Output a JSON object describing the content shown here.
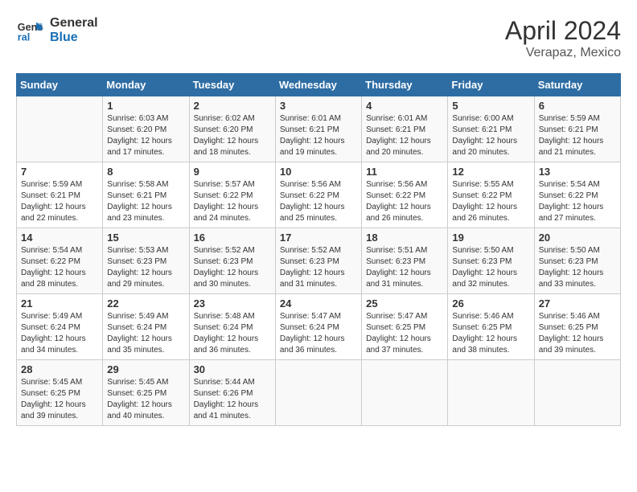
{
  "logo": {
    "line1": "General",
    "line2": "Blue"
  },
  "title": "April 2024",
  "subtitle": "Verapaz, Mexico",
  "days_header": [
    "Sunday",
    "Monday",
    "Tuesday",
    "Wednesday",
    "Thursday",
    "Friday",
    "Saturday"
  ],
  "weeks": [
    [
      {
        "num": "",
        "info": ""
      },
      {
        "num": "1",
        "info": "Sunrise: 6:03 AM\nSunset: 6:20 PM\nDaylight: 12 hours\nand 17 minutes."
      },
      {
        "num": "2",
        "info": "Sunrise: 6:02 AM\nSunset: 6:20 PM\nDaylight: 12 hours\nand 18 minutes."
      },
      {
        "num": "3",
        "info": "Sunrise: 6:01 AM\nSunset: 6:21 PM\nDaylight: 12 hours\nand 19 minutes."
      },
      {
        "num": "4",
        "info": "Sunrise: 6:01 AM\nSunset: 6:21 PM\nDaylight: 12 hours\nand 20 minutes."
      },
      {
        "num": "5",
        "info": "Sunrise: 6:00 AM\nSunset: 6:21 PM\nDaylight: 12 hours\nand 20 minutes."
      },
      {
        "num": "6",
        "info": "Sunrise: 5:59 AM\nSunset: 6:21 PM\nDaylight: 12 hours\nand 21 minutes."
      }
    ],
    [
      {
        "num": "7",
        "info": "Sunrise: 5:59 AM\nSunset: 6:21 PM\nDaylight: 12 hours\nand 22 minutes."
      },
      {
        "num": "8",
        "info": "Sunrise: 5:58 AM\nSunset: 6:21 PM\nDaylight: 12 hours\nand 23 minutes."
      },
      {
        "num": "9",
        "info": "Sunrise: 5:57 AM\nSunset: 6:22 PM\nDaylight: 12 hours\nand 24 minutes."
      },
      {
        "num": "10",
        "info": "Sunrise: 5:56 AM\nSunset: 6:22 PM\nDaylight: 12 hours\nand 25 minutes."
      },
      {
        "num": "11",
        "info": "Sunrise: 5:56 AM\nSunset: 6:22 PM\nDaylight: 12 hours\nand 26 minutes."
      },
      {
        "num": "12",
        "info": "Sunrise: 5:55 AM\nSunset: 6:22 PM\nDaylight: 12 hours\nand 26 minutes."
      },
      {
        "num": "13",
        "info": "Sunrise: 5:54 AM\nSunset: 6:22 PM\nDaylight: 12 hours\nand 27 minutes."
      }
    ],
    [
      {
        "num": "14",
        "info": "Sunrise: 5:54 AM\nSunset: 6:22 PM\nDaylight: 12 hours\nand 28 minutes."
      },
      {
        "num": "15",
        "info": "Sunrise: 5:53 AM\nSunset: 6:23 PM\nDaylight: 12 hours\nand 29 minutes."
      },
      {
        "num": "16",
        "info": "Sunrise: 5:52 AM\nSunset: 6:23 PM\nDaylight: 12 hours\nand 30 minutes."
      },
      {
        "num": "17",
        "info": "Sunrise: 5:52 AM\nSunset: 6:23 PM\nDaylight: 12 hours\nand 31 minutes."
      },
      {
        "num": "18",
        "info": "Sunrise: 5:51 AM\nSunset: 6:23 PM\nDaylight: 12 hours\nand 31 minutes."
      },
      {
        "num": "19",
        "info": "Sunrise: 5:50 AM\nSunset: 6:23 PM\nDaylight: 12 hours\nand 32 minutes."
      },
      {
        "num": "20",
        "info": "Sunrise: 5:50 AM\nSunset: 6:23 PM\nDaylight: 12 hours\nand 33 minutes."
      }
    ],
    [
      {
        "num": "21",
        "info": "Sunrise: 5:49 AM\nSunset: 6:24 PM\nDaylight: 12 hours\nand 34 minutes."
      },
      {
        "num": "22",
        "info": "Sunrise: 5:49 AM\nSunset: 6:24 PM\nDaylight: 12 hours\nand 35 minutes."
      },
      {
        "num": "23",
        "info": "Sunrise: 5:48 AM\nSunset: 6:24 PM\nDaylight: 12 hours\nand 36 minutes."
      },
      {
        "num": "24",
        "info": "Sunrise: 5:47 AM\nSunset: 6:24 PM\nDaylight: 12 hours\nand 36 minutes."
      },
      {
        "num": "25",
        "info": "Sunrise: 5:47 AM\nSunset: 6:25 PM\nDaylight: 12 hours\nand 37 minutes."
      },
      {
        "num": "26",
        "info": "Sunrise: 5:46 AM\nSunset: 6:25 PM\nDaylight: 12 hours\nand 38 minutes."
      },
      {
        "num": "27",
        "info": "Sunrise: 5:46 AM\nSunset: 6:25 PM\nDaylight: 12 hours\nand 39 minutes."
      }
    ],
    [
      {
        "num": "28",
        "info": "Sunrise: 5:45 AM\nSunset: 6:25 PM\nDaylight: 12 hours\nand 39 minutes."
      },
      {
        "num": "29",
        "info": "Sunrise: 5:45 AM\nSunset: 6:25 PM\nDaylight: 12 hours\nand 40 minutes."
      },
      {
        "num": "30",
        "info": "Sunrise: 5:44 AM\nSunset: 6:26 PM\nDaylight: 12 hours\nand 41 minutes."
      },
      {
        "num": "",
        "info": ""
      },
      {
        "num": "",
        "info": ""
      },
      {
        "num": "",
        "info": ""
      },
      {
        "num": "",
        "info": ""
      }
    ]
  ]
}
